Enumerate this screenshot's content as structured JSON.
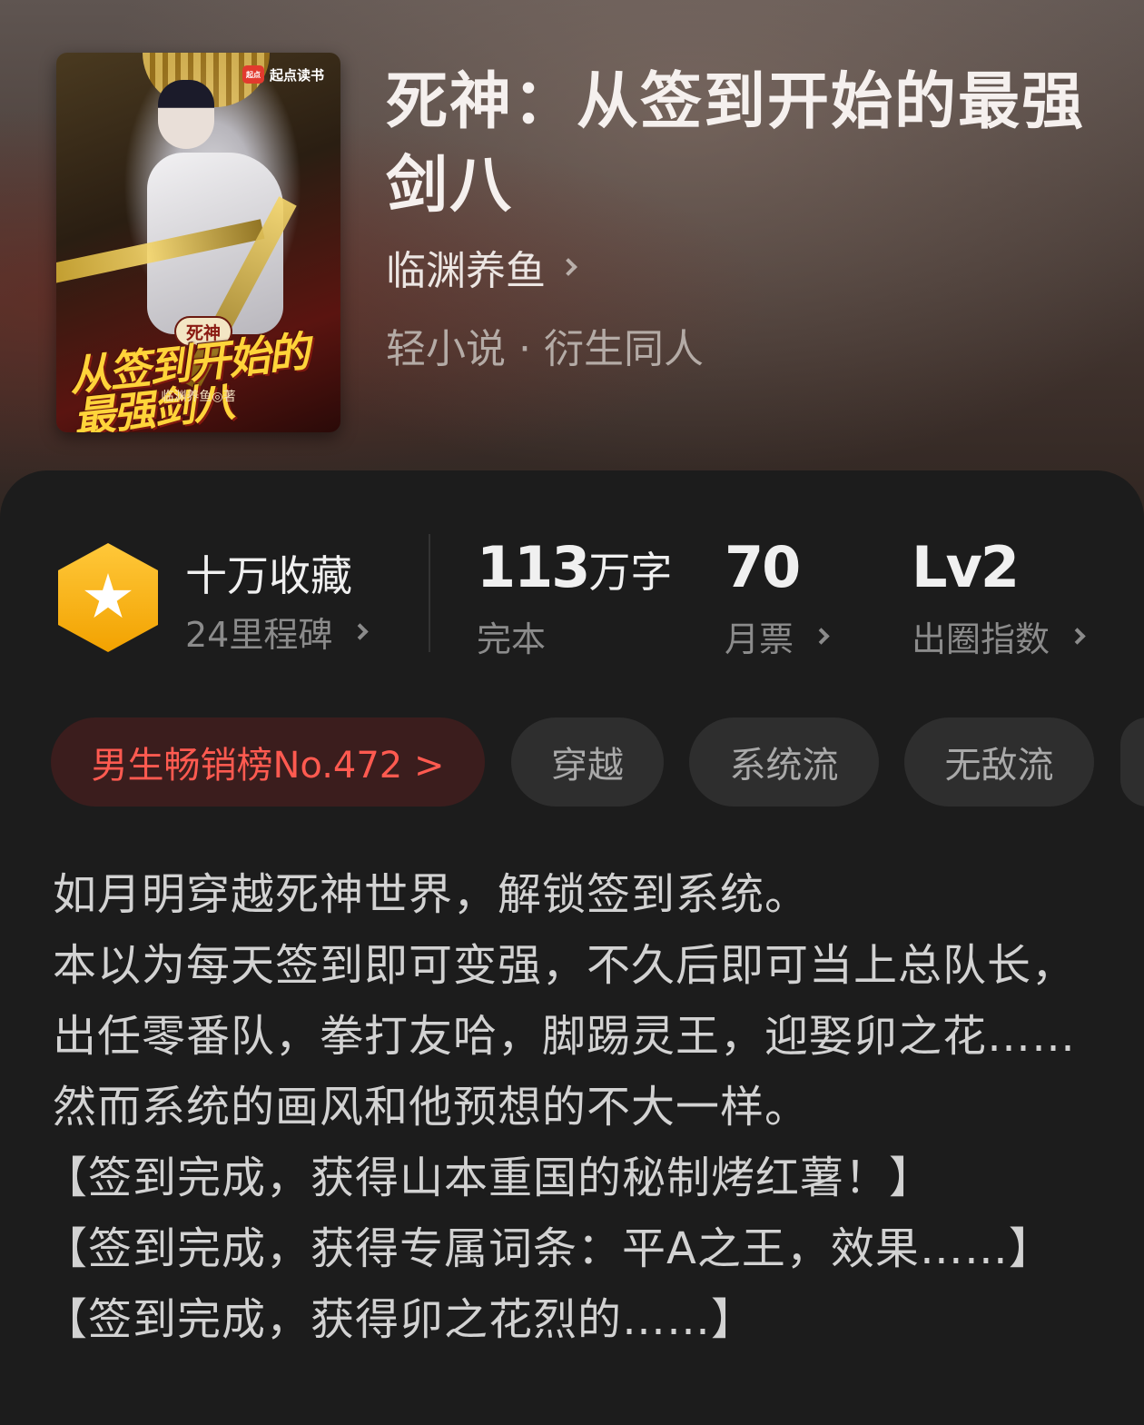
{
  "book": {
    "title": "死神：从签到开始的最强剑八",
    "author": "临渊养鱼",
    "genre": "轻小说 · 衍生同人",
    "cover": {
      "brand": "起点读书",
      "brand_logo": "起点",
      "badge": "死神",
      "title_art": "从签到开始的最强剑八",
      "author_line": "临渊养鱼◎著"
    }
  },
  "stats": {
    "collect": {
      "title": "十万收藏",
      "sub": "24里程碑",
      "icon": "star-hexagon-icon"
    },
    "words": {
      "number": "113",
      "unit": "万字",
      "sub": "完本"
    },
    "monthly": {
      "number": "70",
      "sub": "月票"
    },
    "level": {
      "number": "Lv2",
      "sub": "出圈指数"
    }
  },
  "tags": {
    "rank": "男生畅销榜No.472 >",
    "items": [
      "穿越",
      "系统流",
      "无敌流"
    ]
  },
  "synopsis": [
    "如月明穿越死神世界，解锁签到系统。",
    "本以为每天签到即可变强，不久后即可当上总队长，出任零番队，拳打友哈，脚踢灵王，迎娶卯之花……",
    "然而系统的画风和他预想的不大一样。",
    "【签到完成，获得山本重国的秘制烤红薯！】",
    "【签到完成，获得专属词条：平A之王，效果……】",
    "【签到完成，获得卯之花烈的……】"
  ],
  "colors": {
    "accent_red": "#ff5a50",
    "hex_gold": "#f2a200",
    "panel": "#1c1c1c"
  }
}
